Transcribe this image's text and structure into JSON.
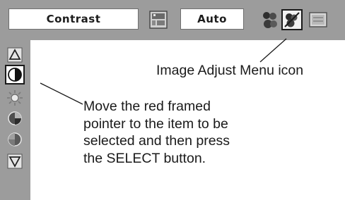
{
  "menu_bar": {
    "item_label": "Contrast",
    "mode_value": "Auto",
    "icons": [
      "scene-icon",
      "user-group-icon",
      "image-adjust-menu-icon",
      "screen-menu-icon"
    ],
    "selected_icon": "image-adjust-menu-icon"
  },
  "side_menu": {
    "items": [
      "arrow-up-icon",
      "contrast-icon",
      "brightness-icon",
      "color-icon",
      "tint-icon",
      "arrow-down-icon"
    ],
    "selected_item": "contrast-icon"
  },
  "annotations": {
    "menu_icon_label": "Image Adjust Menu icon",
    "instruction_lines": [
      "Move the red framed",
      "pointer to the item to be",
      "selected and then press",
      "the SELECT button."
    ]
  }
}
